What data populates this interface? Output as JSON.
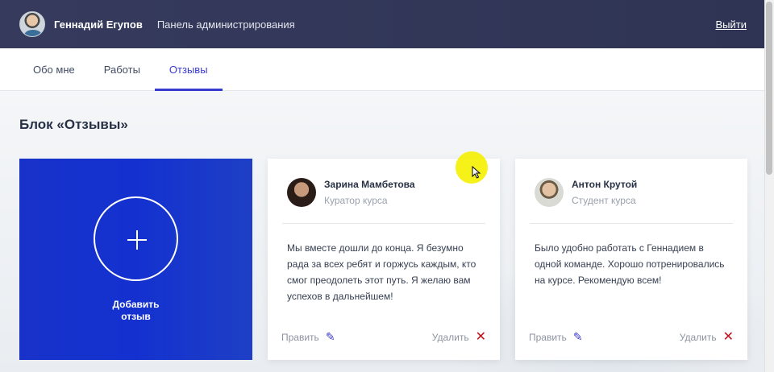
{
  "header": {
    "user_name": "Геннадий Егупов",
    "admin_title": "Панель администрирования",
    "logout_label": "Выйти"
  },
  "tabs": [
    {
      "label": "Обо мне",
      "active": false
    },
    {
      "label": "Работы",
      "active": false
    },
    {
      "label": "Отзывы",
      "active": true
    }
  ],
  "main": {
    "section_title": "Блок «Отзывы»",
    "add_card_label": "Добавить\nотзыв"
  },
  "reviews": [
    {
      "name": "Зарина Мамбетова",
      "role": "Куратор курса",
      "text": "Мы вместе дошли до конца. Я безумно рада за всех ребят и горжусь каждым, кто смог преодолеть этот путь. Я желаю вам успехов в дальнейшем!",
      "edit_label": "Править",
      "delete_label": "Удалить"
    },
    {
      "name": "Антон Крутой",
      "role": "Студент курса",
      "text": "Было удобно работать с Геннадием в одной команде. Хорошо потренировались на курсе. Рекомендую всем!",
      "edit_label": "Править",
      "delete_label": "Удалить"
    }
  ],
  "colors": {
    "header_bg": "#363b5e",
    "accent": "#383bcf",
    "add_card_bg": "#1431d0",
    "delete": "#c0101a"
  },
  "icons": {
    "edit": "pencil-icon",
    "delete": "close-icon",
    "add": "plus-icon"
  }
}
